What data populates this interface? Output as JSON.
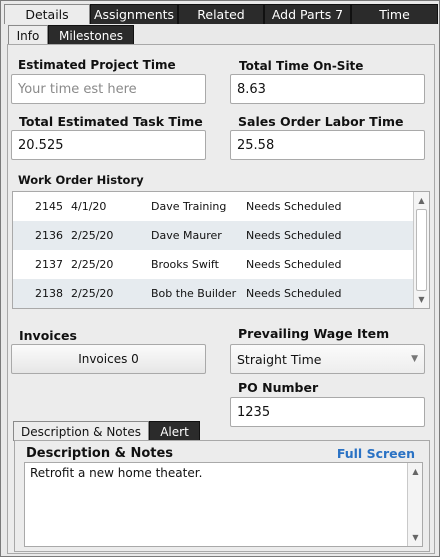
{
  "top_tabs": [
    {
      "label": "Details",
      "active": true
    },
    {
      "label": "Assignments",
      "active": false
    },
    {
      "label": "Related",
      "active": false
    },
    {
      "label": "Add Parts 7",
      "active": false
    },
    {
      "label": "Time",
      "active": false
    }
  ],
  "sub_tabs": [
    {
      "label": "Info",
      "active": true
    },
    {
      "label": "Milestones",
      "active": false
    }
  ],
  "fields": {
    "estimated_project_time": {
      "label": "Estimated Project Time",
      "placeholder": "Your time est here",
      "value": ""
    },
    "total_time_on_site": {
      "label": "Total Time On-Site",
      "value": "8.63"
    },
    "total_estimated_task_time": {
      "label": "Total Estimated Task Time",
      "value": "20.525"
    },
    "sales_order_labor_time": {
      "label": "Sales Order Labor Time",
      "value": "25.58"
    }
  },
  "work_order_history": {
    "title": "Work Order History",
    "rows": [
      {
        "id": "2145",
        "date": "4/1/20",
        "name": "Dave Training",
        "status": "Needs Scheduled"
      },
      {
        "id": "2136",
        "date": "2/25/20",
        "name": "Dave Maurer",
        "status": "Needs Scheduled"
      },
      {
        "id": "2137",
        "date": "2/25/20",
        "name": "Brooks Swift",
        "status": "Needs Scheduled"
      },
      {
        "id": "2138",
        "date": "2/25/20",
        "name": "Bob the Builder",
        "status": "Needs Scheduled"
      }
    ]
  },
  "invoices": {
    "label": "Invoices",
    "button_label": "Invoices 0"
  },
  "prevailing_wage": {
    "label": "Prevailing Wage Item",
    "selected": "Straight Time"
  },
  "po_number": {
    "label": "PO Number",
    "value": "1235"
  },
  "bottom_tabs": [
    {
      "label": "Description & Notes",
      "active": true
    },
    {
      "label": "Alert",
      "active": false
    }
  ],
  "description": {
    "title": "Description & Notes",
    "full_screen_label": "Full Screen",
    "text": "Retrofit a new home theater."
  },
  "colors": {
    "accent_link": "#2a72c4",
    "tab_dark": "#2b2b2b",
    "row_alt": "#e6ebef"
  },
  "icons": {
    "scroll_up": "up-arrow-icon",
    "scroll_down": "down-arrow-icon",
    "dropdown": "chevron-down-icon"
  }
}
